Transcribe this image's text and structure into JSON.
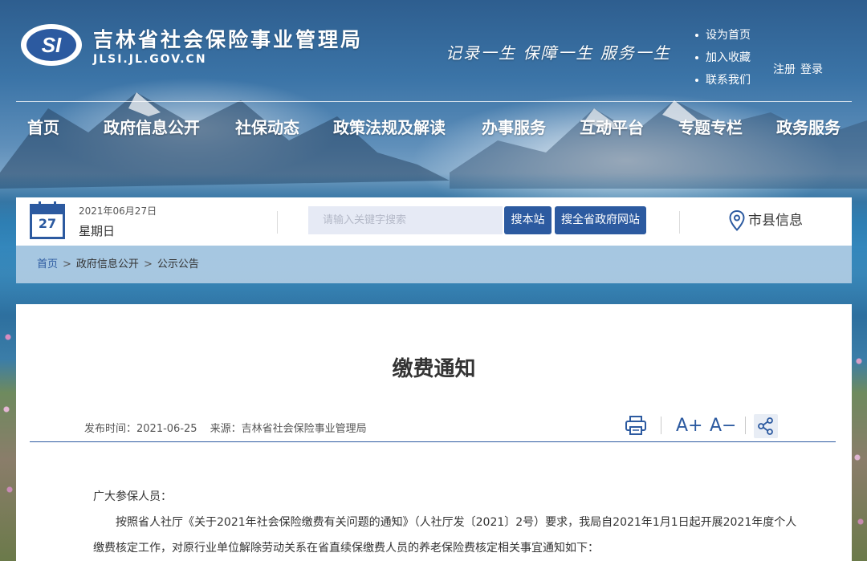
{
  "header": {
    "site_name": "吉林省社会保险事业管理局",
    "site_domain": "JLSI.JL.GOV.CN",
    "logo_text": "SI",
    "slogan": "记录一生 保障一生 服务一生",
    "quick_links": [
      "设为首页",
      "加入收藏",
      "联系我们"
    ],
    "register_label": "注册",
    "login_label": "登录"
  },
  "nav": {
    "items": [
      "首页",
      "政府信息公开",
      "社保动态",
      "政策法规及解读",
      "办事服务",
      "互动平台",
      "专题专栏",
      "政务服务"
    ]
  },
  "info_bar": {
    "calendar_day": "27",
    "date": "2021年06月27日",
    "weekday": "星期日",
    "search_placeholder": "请输入关键字搜索",
    "search_site_label": "搜本站",
    "search_gov_label": "搜全省政府网站",
    "city_info_label": "市县信息"
  },
  "breadcrumb": {
    "items": [
      "首页",
      "政府信息公开",
      "公示公告"
    ],
    "separator": ">"
  },
  "article": {
    "title": "缴费通知",
    "publish_time": "发布时间：2021-06-25",
    "source": "来源：吉林省社会保险事业管理局",
    "font_increase_label": "A+",
    "font_decrease_label": "A−",
    "greeting": "广大参保人员：",
    "paragraph_1_line_1": "按照省人社厅《关于2021年社会保险缴费有关问题的通知》（人社厅发〔2021〕2号）要求，我局自2021年1月1日起开展2021年度个人",
    "paragraph_1_line_2": "缴费核定工作，对原行业单位解除劳动关系在省直续保缴费人员的养老保险费核定相关事宜通知如下："
  },
  "colors": {
    "accent": "#2c5aa0",
    "search_bg": "#e6eaf5",
    "text": "#333333"
  },
  "icons": [
    "calendar-icon",
    "location-pin-icon",
    "print-icon",
    "share-icon"
  ]
}
